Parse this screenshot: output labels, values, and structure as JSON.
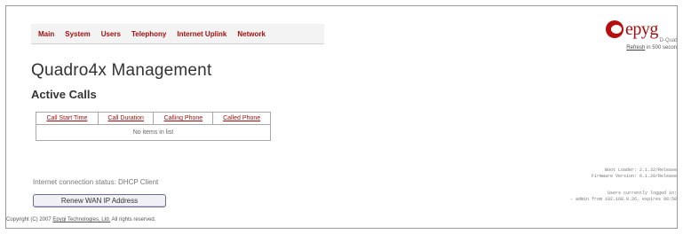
{
  "nav": {
    "items": [
      "Main",
      "System",
      "Users",
      "Telephony",
      "Internet Uplink",
      "Network"
    ]
  },
  "logo": {
    "text": "epyg",
    "subtext": "D-Quat",
    "color": "#a30f0f"
  },
  "refresh": {
    "link": "Refresh",
    "text": "in 500 secon"
  },
  "page": {
    "title": "Quadro4x Management",
    "section": "Active Calls"
  },
  "table": {
    "columns": [
      "Call Start Time",
      "Call Duration",
      "Calling Phone",
      "Called Phone"
    ],
    "empty_message": "No items in list"
  },
  "status": {
    "text": "Internet connection status: DHCP Client"
  },
  "buttons": {
    "renew_label": "Renew WAN IP Address"
  },
  "info": {
    "boot_loader": "Boot Loader: 2.1.32/Release",
    "firmware": "Firmware Version: 6.1.20/Release",
    "users_line": "Users currently logged in:",
    "admin_line": "- admin from 192.168.0.26, expires 08:58"
  },
  "footer": {
    "prefix": "Copyright (C) 2007",
    "link": "Epygi Technologies, Ltd.",
    "suffix": "All rights reserved."
  }
}
